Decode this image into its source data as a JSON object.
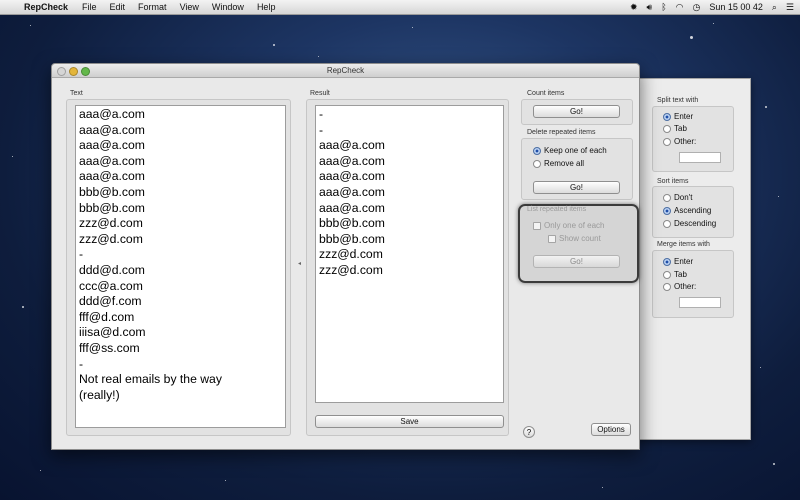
{
  "menubar": {
    "app_name": "RepCheck",
    "items": [
      "File",
      "Edit",
      "Format",
      "View",
      "Window",
      "Help"
    ],
    "clock": "Sun 15 00 42"
  },
  "window": {
    "title": "RepCheck",
    "text_label": "Text",
    "result_label": "Result",
    "text_lines": [
      "aaa@a.com",
      "aaa@a.com",
      "aaa@a.com",
      "aaa@a.com",
      "aaa@a.com",
      "bbb@b.com",
      "bbb@b.com",
      "zzz@d.com",
      "zzz@d.com",
      "-",
      "ddd@d.com",
      "ccc@a.com",
      "ddd@f.com",
      "fff@d.com",
      "iiisa@d.com",
      "fff@ss.com",
      "-",
      "Not real emails by the way",
      "(really!)"
    ],
    "result_lines": [
      "-",
      "-",
      "aaa@a.com",
      "aaa@a.com",
      "aaa@a.com",
      "aaa@a.com",
      "aaa@a.com",
      "bbb@b.com",
      "bbb@b.com",
      "zzz@d.com",
      "zzz@d.com"
    ],
    "save_label": "Save",
    "count_items": {
      "label": "Count items",
      "go": "Go!"
    },
    "delete_repeated": {
      "label": "Delete repeated items",
      "keep_one": "Keep one of each",
      "remove_all": "Remove all",
      "selected": "keep_one",
      "go": "Go!"
    },
    "list_repeated": {
      "label": "List repeated items",
      "only_one": "Only one of each",
      "show_count": "Show count",
      "go": "Go!"
    },
    "help": "?",
    "options_label": "Options"
  },
  "drawer": {
    "split": {
      "label": "Split text with",
      "options": [
        "Enter",
        "Tab",
        "Other:"
      ],
      "selected": "Enter"
    },
    "sort": {
      "label": "Sort items",
      "options": [
        "Don't",
        "Ascending",
        "Descending"
      ],
      "selected": "Ascending"
    },
    "merge": {
      "label": "Merge items with",
      "options": [
        "Enter",
        "Tab",
        "Other:"
      ],
      "selected": "Enter"
    }
  }
}
